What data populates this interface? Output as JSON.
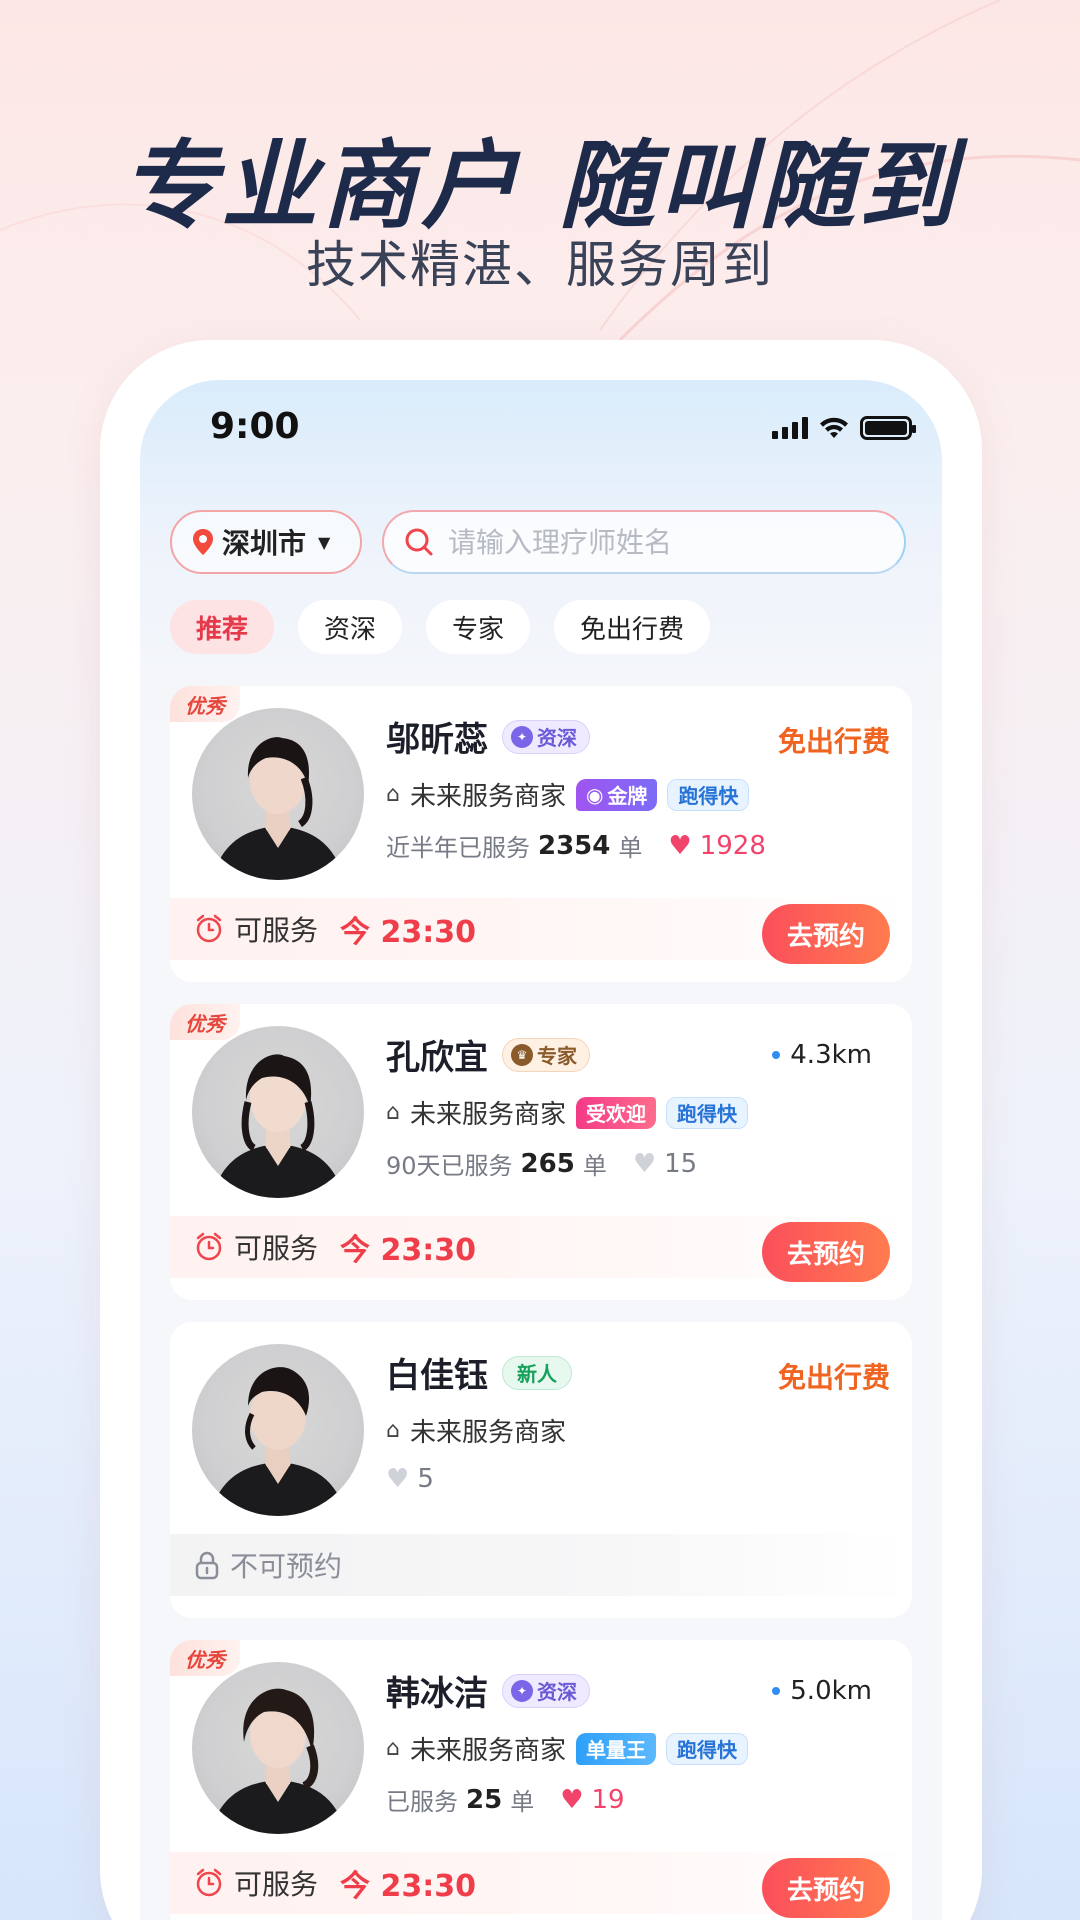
{
  "hero": {
    "title": "专业商户 随叫随到",
    "subtitle": "技术精湛、服务周到"
  },
  "status_bar": {
    "time": "9:00"
  },
  "header": {
    "city": "深圳市",
    "search_placeholder": "请输入理疗师姓名"
  },
  "filters": [
    "推荐",
    "资深",
    "专家",
    "免出行费"
  ],
  "therapists": [
    {
      "badge": "优秀",
      "name": "邬昕蕊",
      "level_tag": "资深",
      "right_note": "免出行费",
      "merchant": "未来服务商家",
      "tags": [
        "金牌",
        "跑得快"
      ],
      "stats_label": "近半年已服务",
      "orders": "2354",
      "order_unit": "单",
      "likes": "1928",
      "available_label": "可服务",
      "available_time": "今 23:30",
      "book_label": "去预约"
    },
    {
      "badge": "优秀",
      "name": "孔欣宜",
      "level_tag": "专家",
      "distance": "4.3km",
      "merchant": "未来服务商家",
      "tags": [
        "受欢迎",
        "跑得快"
      ],
      "stats_label": "90天已服务",
      "orders": "265",
      "order_unit": "单",
      "likes": "15",
      "available_label": "可服务",
      "available_time": "今 23:30",
      "book_label": "去预约"
    },
    {
      "name": "白佳钰",
      "level_tag": "新人",
      "right_note": "免出行费",
      "merchant": "未来服务商家",
      "likes": "5",
      "unavailable_label": "不可预约"
    },
    {
      "badge": "优秀",
      "name": "韩冰洁",
      "level_tag": "资深",
      "distance": "5.0km",
      "merchant": "未来服务商家",
      "tags": [
        "单量王",
        "跑得快"
      ],
      "stats_label": "已服务",
      "orders": "25",
      "order_unit": "单",
      "likes": "19",
      "available_label": "可服务",
      "available_time": "今 23:30",
      "book_label": "去预约"
    }
  ],
  "colors": {
    "accent_red": "#ef3e4a",
    "accent_orange": "#f06422",
    "title_navy": "#1e2a4a"
  }
}
